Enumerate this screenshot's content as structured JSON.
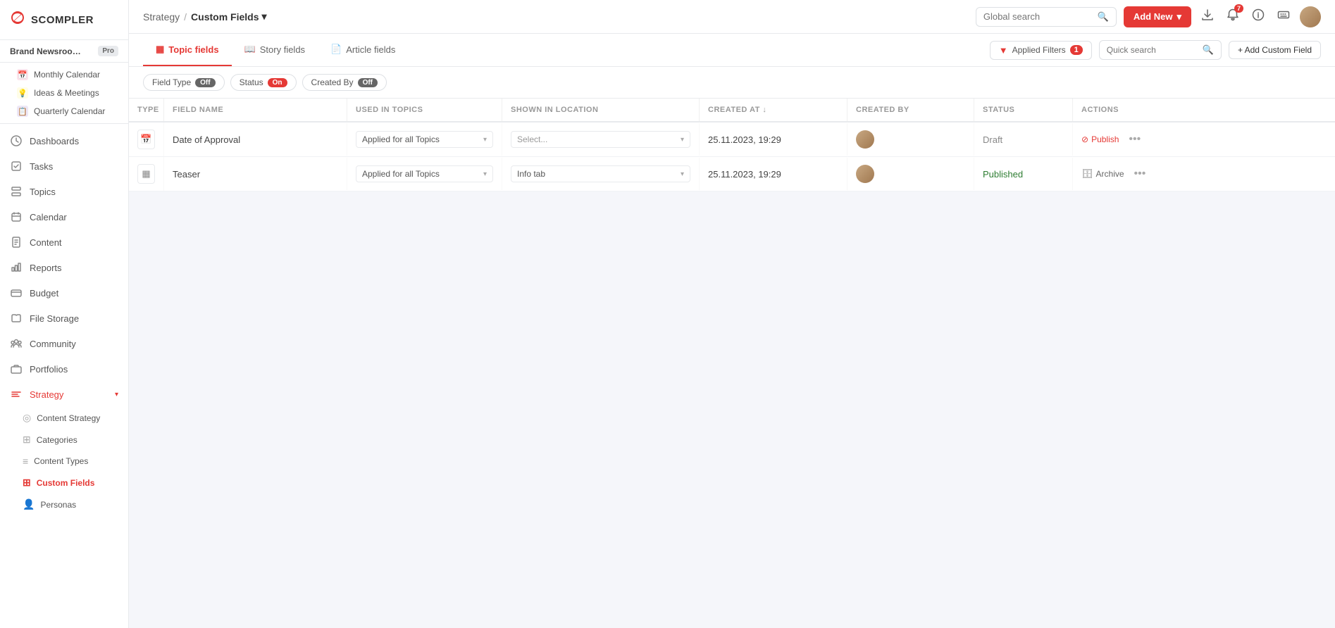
{
  "app": {
    "logo": "S",
    "name": "SCOMPLER"
  },
  "workspace": {
    "name": "Brand Newsroom De...",
    "plan": "Pro"
  },
  "sidebar_sub_items": [
    {
      "label": "Monthly Calendar",
      "icon": "📅",
      "color": "#e53935"
    },
    {
      "label": "Ideas & Meetings",
      "icon": "💡",
      "color": "#f5a623"
    },
    {
      "label": "Quarterly Calendar",
      "icon": "📋",
      "color": "#7b68ee"
    }
  ],
  "sidebar_nav": [
    {
      "label": "Dashboards",
      "icon": "grid"
    },
    {
      "label": "Tasks",
      "icon": "check"
    },
    {
      "label": "Topics",
      "icon": "layers"
    },
    {
      "label": "Calendar",
      "icon": "calendar"
    },
    {
      "label": "Content",
      "icon": "file"
    },
    {
      "label": "Reports",
      "icon": "bar-chart"
    },
    {
      "label": "Budget",
      "icon": "wallet"
    },
    {
      "label": "File Storage",
      "icon": "folder"
    },
    {
      "label": "Community",
      "icon": "users"
    },
    {
      "label": "Portfolios",
      "icon": "briefcase"
    },
    {
      "label": "Strategy",
      "icon": "sliders",
      "active": true,
      "expandable": true
    }
  ],
  "strategy_children": [
    {
      "label": "Content Strategy",
      "icon": "circle"
    },
    {
      "label": "Categories",
      "icon": "grid-small"
    },
    {
      "label": "Content Types",
      "icon": "layers-small"
    },
    {
      "label": "Custom Fields",
      "icon": "grid-dots",
      "active": true
    },
    {
      "label": "Personas",
      "icon": "person"
    }
  ],
  "topbar": {
    "breadcrumb_parent": "Strategy",
    "breadcrumb_sep": "/",
    "breadcrumb_current": "Custom Fields",
    "dropdown_arrow": "▾",
    "global_search_placeholder": "Global search",
    "add_new_label": "Add New",
    "notifications_count": "7"
  },
  "tabs": [
    {
      "label": "Topic fields",
      "icon": "▦",
      "active": true
    },
    {
      "label": "Story fields",
      "icon": "📖",
      "active": false
    },
    {
      "label": "Article fields",
      "icon": "📄",
      "active": false
    }
  ],
  "filter_chips": [
    {
      "label": "Field Type",
      "toggle": "Off",
      "on": false
    },
    {
      "label": "Status",
      "toggle": "On",
      "on": true
    },
    {
      "label": "Created By",
      "toggle": "Off",
      "on": false
    }
  ],
  "filter_bar": {
    "applied_filters_label": "Applied Filters",
    "applied_filters_count": "1",
    "quick_search_placeholder": "Quick search",
    "add_custom_field_label": "+ Add Custom Field"
  },
  "table": {
    "columns": [
      "TYPE",
      "FIELD NAME",
      "USED IN TOPICS",
      "SHOWN IN LOCATION",
      "CREATED AT ↓",
      "CREATED BY",
      "STATUS",
      "ACTIONS"
    ],
    "rows": [
      {
        "type_icon": "📅",
        "field_name": "Date of Approval",
        "used_in_topics": "Applied for all Topics",
        "shown_in_location": "Select...",
        "shown_has_value": false,
        "created_at": "25.11.2023, 19:29",
        "status": "Draft",
        "status_published": false,
        "action_label": "Publish",
        "action_icon": "⊘"
      },
      {
        "type_icon": "▦",
        "field_name": "Teaser",
        "used_in_topics": "Applied for all Topics",
        "shown_in_location": "Info tab",
        "shown_has_value": true,
        "created_at": "25.11.2023, 19:29",
        "status": "Published",
        "status_published": true,
        "action_label": "Archive",
        "action_icon": "🗄"
      }
    ]
  }
}
